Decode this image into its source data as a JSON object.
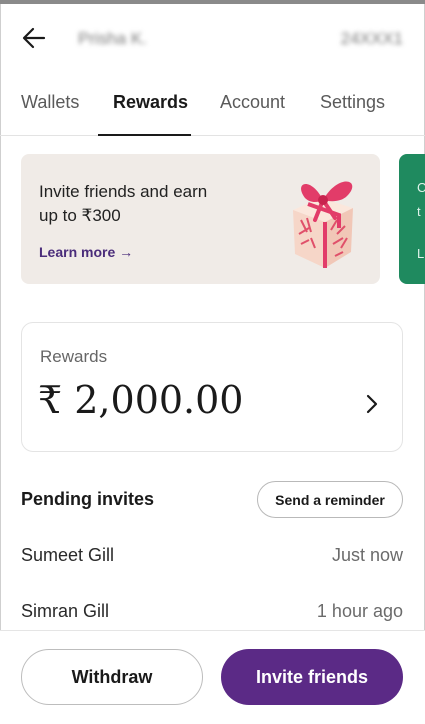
{
  "header": {
    "back_icon": "arrow-left-icon",
    "user_name": "Prisha K.",
    "user_id": "24XXX1"
  },
  "tabs": [
    {
      "label": "Wallets",
      "active": false
    },
    {
      "label": "Rewards",
      "active": true
    },
    {
      "label": "Account",
      "active": false
    },
    {
      "label": "Settings",
      "active": false
    }
  ],
  "promo": {
    "line1": "Invite friends and earn",
    "line2": "up to ₹300",
    "link_label": "Learn more →",
    "image_icon": "gift-box-icon",
    "next_card_text": [
      "C",
      "t",
      "",
      "",
      "L"
    ]
  },
  "rewards": {
    "label": "Rewards",
    "amount": "₹ 2,000.00",
    "chevron_icon": "chevron-right-icon"
  },
  "pending": {
    "title": "Pending invites",
    "reminder_label": "Send a reminder",
    "invites": [
      {
        "name": "Sumeet Gill",
        "time": "Just now"
      },
      {
        "name": "Simran Gill",
        "time": "1 hour ago"
      }
    ]
  },
  "footer": {
    "withdraw_label": "Withdraw",
    "invite_label": "Invite friends"
  },
  "colors": {
    "accent": "#5b2a86",
    "promo_bg": "#f0ebe7",
    "next_card_bg": "#1f8a5f",
    "link": "#4a2c7a"
  }
}
